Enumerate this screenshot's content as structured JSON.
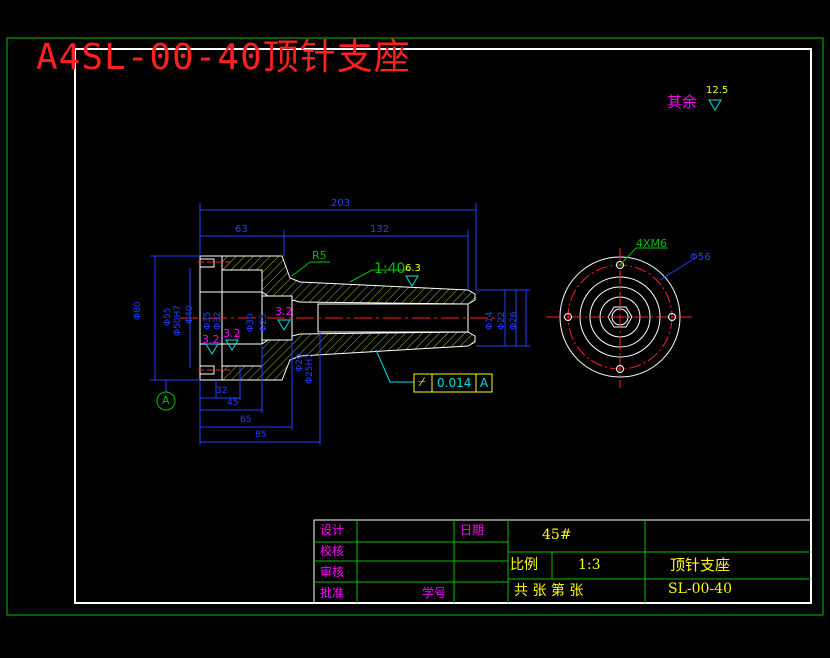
{
  "title": "A4SL-00-40顶针支座",
  "roughness": {
    "label": "其余",
    "value": "12.5"
  },
  "dimensions": {
    "total_length": "203",
    "left_length": "63",
    "right_length": "132",
    "fillet": "R5",
    "taper": "1:40",
    "surface_roughness": [
      "6.3",
      "3.2",
      "3.2",
      "3.2"
    ],
    "tolerance_symbol": "⌿",
    "tolerance_value": "0.014",
    "datum": "A",
    "bottom_dims": [
      "32",
      "45",
      "65",
      "85"
    ],
    "bolt_pattern": "4XM6",
    "hole_dia": "Φ56",
    "left_vertical": [
      "Φ80",
      "Φ55",
      "Φ50H7",
      "Φ40",
      "Φ35",
      "Φ32"
    ],
    "mid_vertical": [
      "Φ30",
      "Φ25",
      "Φ20",
      "Φ25H7"
    ],
    "right_vertical": [
      "Φ14",
      "Φ22",
      "Φ26"
    ]
  },
  "title_block": {
    "design": "设计",
    "check": "校核",
    "review": "审核",
    "approve": "批准",
    "date": "日期",
    "student_no": "学号",
    "material": "45#",
    "scale_label": "比例",
    "scale": "1:3",
    "sheets": "共  张  第  张",
    "part_name": "顶针支座",
    "drawing_no": "SL-00-40"
  },
  "colors": {
    "background": "#000000",
    "border": "#ffffff",
    "frame": "#00c000",
    "title": "#ff2020",
    "dimension": "#2040ff",
    "hatch": "#a0c020",
    "label": "#ff00ff",
    "centerline": "#ff2020",
    "annotation": "#00e0e0",
    "note": "#ffff00"
  }
}
